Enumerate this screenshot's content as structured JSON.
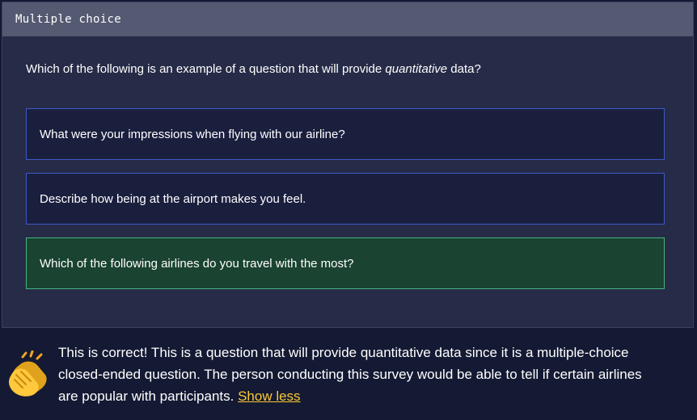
{
  "header": {
    "title": "Multiple choice"
  },
  "question": {
    "before": "Which of the following is an example of a question that will provide ",
    "emphasis": "quantitative",
    "after": " data?"
  },
  "options": [
    {
      "label": "What were your impressions when flying with our airline?"
    },
    {
      "label": "Describe how being at the airport makes you feel."
    },
    {
      "label": "Which of the following airlines do you travel with the most?",
      "state": "correct"
    }
  ],
  "feedback": {
    "icon": "clapping-hands-icon",
    "text": "This is correct! This is a question that will provide quantitative data since it is a multiple-choice closed-ended question. The person conducting this survey would be able to tell if certain airlines are popular with participants.",
    "toggle_label": "Show less"
  },
  "colors": {
    "correct_bg": "#1a4331",
    "correct_border": "#46b582",
    "option_border": "#3d59c7",
    "link": "#fcc934"
  }
}
